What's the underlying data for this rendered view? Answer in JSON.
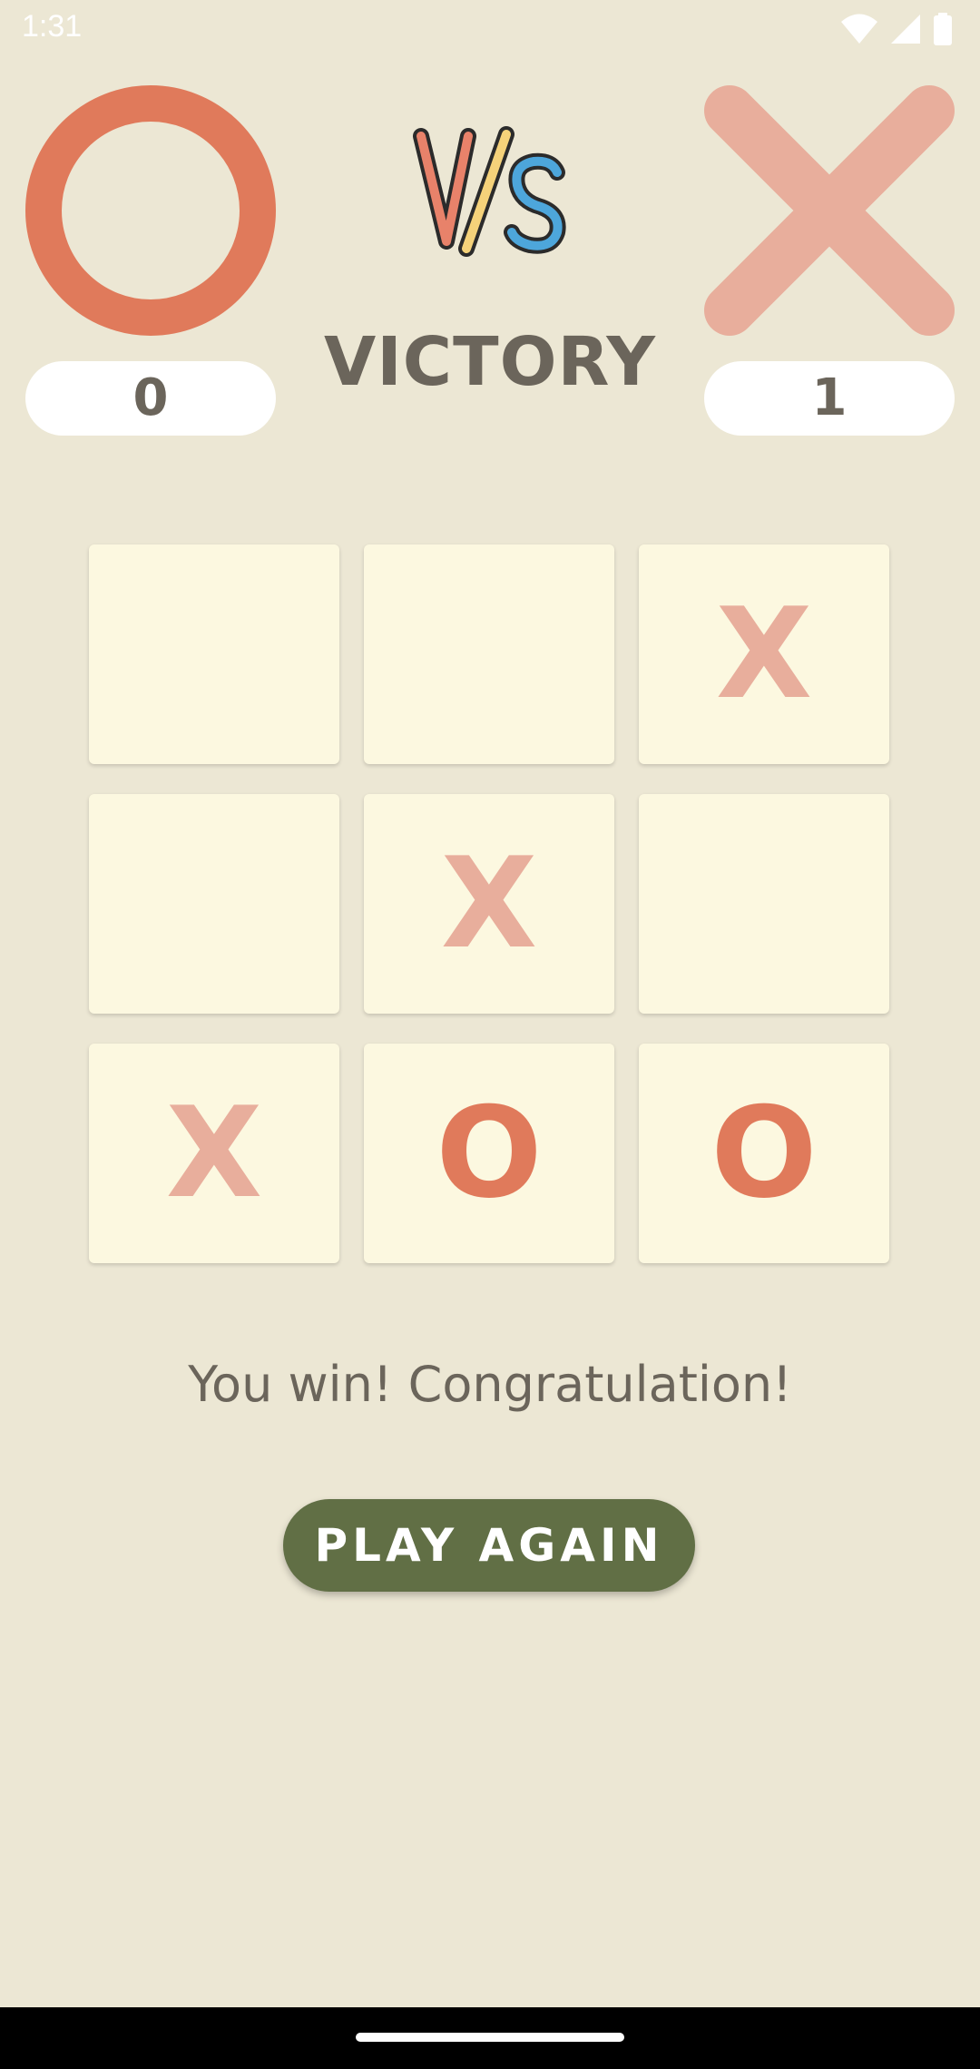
{
  "status_bar": {
    "time": "1:31",
    "icons": [
      "wifi-icon",
      "signal-icon",
      "battery-icon"
    ]
  },
  "players": {
    "o": {
      "symbol": "O",
      "score": "0",
      "color": "#E07A5B"
    },
    "x": {
      "symbol": "X",
      "score": "1",
      "color": "#E8AE9C"
    }
  },
  "vs_logo": {
    "text": "VS",
    "colors": [
      "#E8826A",
      "#F5D27A",
      "#4DA6DB"
    ]
  },
  "result": {
    "title": "VICTORY",
    "message": "You win! Congratulation!"
  },
  "board": {
    "cells": [
      "",
      "",
      "X",
      "",
      "X",
      "",
      "X",
      "O",
      "O"
    ]
  },
  "actions": {
    "play_again_label": "PLAY AGAIN"
  },
  "colors": {
    "background": "#ECE7D4",
    "cell": "#FCF8E0",
    "text": "#6B655B",
    "button": "#616F45",
    "o_mark": "#E07A5B",
    "x_mark": "#E8AE9C"
  }
}
